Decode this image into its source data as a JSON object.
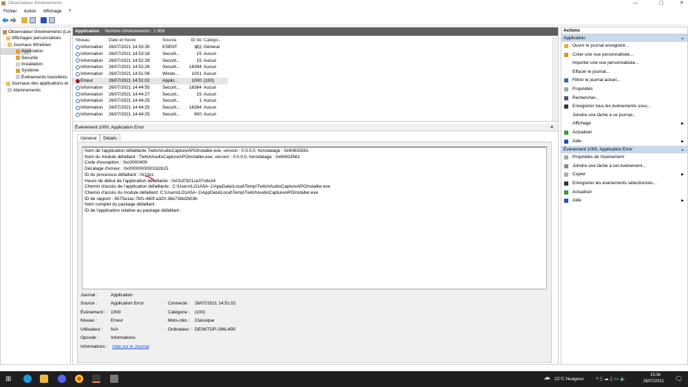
{
  "window": {
    "title": "Observateur d'événements",
    "min": "—",
    "max": "▢",
    "close": "✕"
  },
  "menu": [
    "Fichier",
    "Action",
    "Affichage",
    "?"
  ],
  "tree": [
    {
      "label": "Observateur d'événements (Loc",
      "indent": 0
    },
    {
      "label": "Affichages personnalisés",
      "indent": 1
    },
    {
      "label": "Journaux Windows",
      "indent": 1
    },
    {
      "label": "Application",
      "indent": 2,
      "selected": true
    },
    {
      "label": "Sécurité",
      "indent": 2
    },
    {
      "label": "Installation",
      "indent": 2
    },
    {
      "label": "Système",
      "indent": 2
    },
    {
      "label": "Événements transférés",
      "indent": 2
    },
    {
      "label": "Journaux des applications et",
      "indent": 1
    },
    {
      "label": "Abonnements",
      "indent": 1
    }
  ],
  "center": {
    "title": "Application",
    "count": "Nombre d'événements : 1 958",
    "columns": [
      "Niveau",
      "Date et heure",
      "Source",
      "ID de l'...",
      "Catégo..."
    ],
    "rows": [
      [
        "Information",
        "26/07/2021 14:53:35",
        "ESENT",
        "102",
        "Général"
      ],
      [
        "Information",
        "26/07/2021 14:53:18",
        "Securit...",
        "15",
        "Aucun"
      ],
      [
        "Information",
        "26/07/2021 14:52:39",
        "Securit...",
        "15",
        "Aucun"
      ],
      [
        "Information",
        "26/07/2021 14:52:26",
        "Securit...",
        "16394",
        "Aucun"
      ],
      [
        "Information",
        "26/07/2021 14:51:06",
        "Windo...",
        "1001",
        "Aucun"
      ],
      [
        "Erreur",
        "26/07/2021 14:51:02",
        "Applic...",
        "1000",
        "(100)"
      ],
      [
        "Information",
        "26/07/2021 14:44:55",
        "Securit...",
        "16384",
        "Aucun"
      ],
      [
        "Information",
        "26/07/2021 14:44:27",
        "Securit...",
        "15",
        "Aucun"
      ],
      [
        "Information",
        "26/07/2021 14:44:25",
        "Securit...",
        "1",
        "Aucun"
      ],
      [
        "Information",
        "26/07/2021 14:44:25",
        "Securit...",
        "16394",
        "Aucun"
      ],
      [
        "Information",
        "26/07/2021 14:44:25",
        "Securit...",
        "900",
        "Aucun"
      ]
    ]
  },
  "detail": {
    "title": "Événement 1000, Application Error",
    "close": "✕",
    "tabs": [
      "Général",
      "Détails"
    ],
    "lines": [
      "Nom de l'application défaillante TwitchAudioCaptureAPOInstaller.exe, version : 0.0.0.0, horodatage : 0x60833561",
      "Nom du module défaillant : TwitchAudioCaptureAPOInstaller.exe, version : 0.0.0.0, horodatage : 0x60833561",
      "Code d'exception : 0xc0000409",
      "Décalage d'erreur : 0x0000000000162b15",
      "ID du processus défaillant : 0x13cc",
      "Heure de début de l'application défaillante : 0x01d7821ce37c8e34",
      "Chemin d'accès de l'application défaillante : C:\\Users\\LO1A5A~1\\AppData\\Local\\Temp\\TwitchAudioCaptureAPOInstaller.exe",
      "Chemin d'accès du module défaillant: C:\\Users\\LO1A5A~1\\AppData\\Local\\Temp\\TwitchAudioCaptureAPOInstaller.exe",
      "ID de rapport : 6575e1ac-7bf1-460f-a320-38e738d2b03b",
      "Nom complet du package défaillant :",
      "ID de l'application relative au package défaillant :"
    ],
    "fields": {
      "journal_l": "Journal :",
      "journal": "Application",
      "source_l": "Source :",
      "source": "Application Error",
      "event_l": "Événement :",
      "event": "1000",
      "level_l": "Niveau :",
      "level": "Erreur",
      "user_l": "Utilisateur :",
      "user": "N/A",
      "opcode_l": "Opcode :",
      "opcode": "Informations",
      "info_l": "Informations :",
      "info": "Aide sur le Journal",
      "logged_l": "Connecté :",
      "logged": "26/07/2021 14:51:02",
      "cat_l": "Catégorie :",
      "cat": "(100)",
      "kw_l": "Mots-clés :",
      "kw": "Classique",
      "pc_l": "Ordinateur :",
      "pc": "DESKTOP-296L45R"
    }
  },
  "actions": {
    "title": "Actions",
    "sections": [
      {
        "title": "Application",
        "items": [
          {
            "label": "Ouvrir le journal enregistré...",
            "icon": "folder-icon",
            "color": "#e0b440"
          },
          {
            "label": "Créer une vue personnalisée...",
            "icon": "filter-icon",
            "color": "#d99a1c"
          },
          {
            "label": "Importer une vue personnalisée...",
            "icon": ""
          },
          {
            "label": "Effacer le journal...",
            "icon": ""
          },
          {
            "label": "Filtrer le journal actuel...",
            "icon": "filter-icon",
            "color": "#3a6ea5"
          },
          {
            "label": "Propriétés",
            "icon": "properties-icon",
            "color": "#9aa"
          },
          {
            "label": "Rechercher...",
            "icon": "find-icon",
            "color": "#557"
          },
          {
            "label": "Enregistrer tous les événements sous...",
            "icon": "save-icon",
            "color": "#333"
          },
          {
            "label": "Joindre une tâche à ce journal...",
            "icon": ""
          },
          {
            "label": "Affichage",
            "icon": "",
            "submenu": true
          },
          {
            "label": "Actualiser",
            "icon": "refresh-icon",
            "color": "#3a9a3a"
          },
          {
            "label": "Aide",
            "icon": "help-icon",
            "color": "#2a4fb0",
            "submenu": true
          }
        ]
      },
      {
        "title": "Événement 1000, Application Error",
        "items": [
          {
            "label": "Propriétés de l'événement",
            "icon": "properties-icon",
            "color": "#9aa"
          },
          {
            "label": "Joindre une tâche à cet événement...",
            "icon": "task-icon",
            "color": "#888"
          },
          {
            "label": "Copier",
            "icon": "copy-icon",
            "color": "#aab",
            "submenu": true
          },
          {
            "label": "Enregistrer les événements sélectionnés...",
            "icon": "save-icon",
            "color": "#333"
          },
          {
            "label": "Actualiser",
            "icon": "refresh-icon",
            "color": "#3a9a3a"
          },
          {
            "label": "Aide",
            "icon": "help-icon",
            "color": "#2a4fb0",
            "submenu": true
          }
        ]
      }
    ]
  },
  "taskbar": {
    "weather": "22°C  Nuageux",
    "time": "15:08",
    "date": "26/07/2021"
  }
}
